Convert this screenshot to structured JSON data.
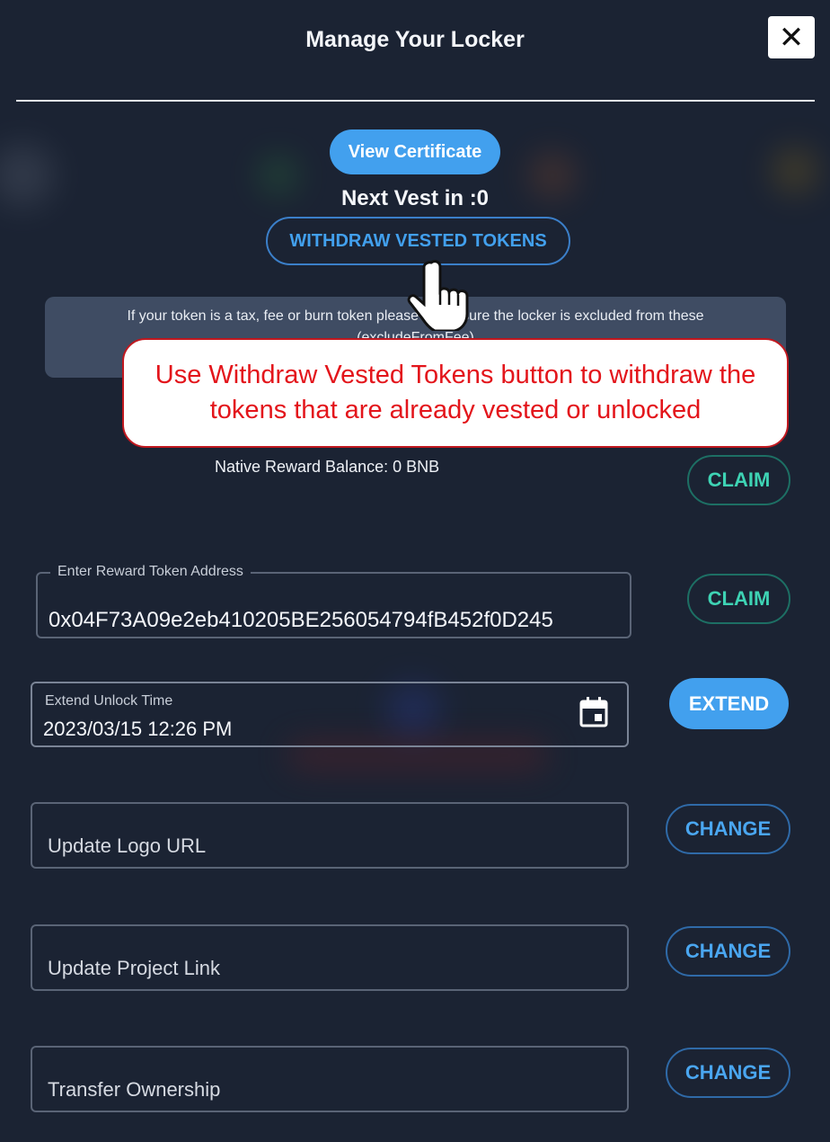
{
  "modal": {
    "title": "Manage Your Locker",
    "close_label": "✕"
  },
  "actions": {
    "view_certificate": "View Certificate",
    "next_vest": "Next Vest in :0",
    "withdraw_vested": "WITHDRAW VESTED TOKENS"
  },
  "info_notice": {
    "line1": "If your token is a tax, fee or burn token please make sure the locker is excluded from these",
    "line2": "(excludeFromFee)"
  },
  "annotation": {
    "text": "Use Withdraw Vested Tokens button to withdraw the tokens that are already vested or unlocked"
  },
  "rewards": {
    "native_balance": "Native Reward Balance: 0 BNB",
    "native_claim": "CLAIM",
    "token_address_label": "Enter Reward Token Address",
    "token_address_value": "0x04F73A09e2eb410205BE256054794fB452f0D245",
    "token_claim": "CLAIM"
  },
  "unlock": {
    "label": "Extend Unlock Time",
    "value": "2023/03/15 12:26 PM",
    "button": "EXTEND",
    "icon": "calendar-icon"
  },
  "updates": [
    {
      "placeholder": "Update Logo URL",
      "button": "CHANGE"
    },
    {
      "placeholder": "Update Project Link",
      "button": "CHANGE"
    },
    {
      "placeholder": "Transfer Ownership",
      "button": "CHANGE"
    }
  ],
  "colors": {
    "background": "#1b2333",
    "primary": "#42a0ee",
    "claim": "#3ed3b4",
    "annotation_red": "#e3151b"
  }
}
